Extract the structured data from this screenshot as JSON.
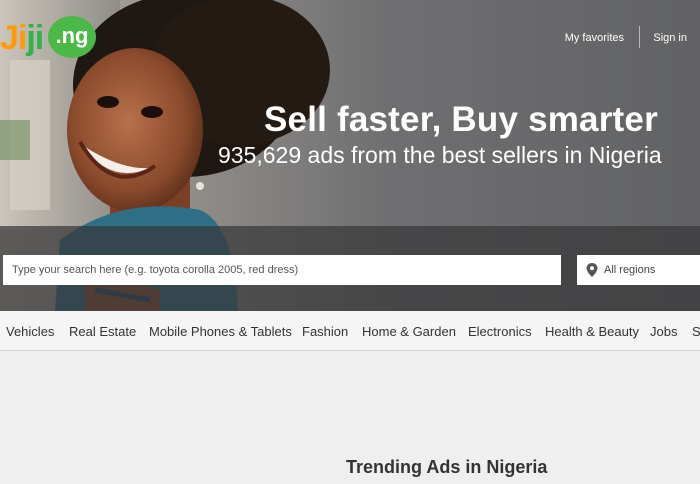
{
  "header": {
    "logo": {
      "part1": "Ji",
      "part2": "ji",
      "suffix": ".ng"
    },
    "favorites_label": "My favorites",
    "signin_label": "Sign in"
  },
  "hero": {
    "title": "Sell faster, Buy smarter",
    "subtitle": "935,629 ads from the best sellers in Nigeria"
  },
  "search": {
    "placeholder": "Type your search here (e.g. toyota corolla 2005, red dress)",
    "value": "",
    "region_label": "All regions"
  },
  "categories": [
    "Vehicles",
    "Real Estate",
    "Mobile Phones & Tablets",
    "Fashion",
    "Home & Garden",
    "Electronics",
    "Health & Beauty",
    "Jobs",
    "S"
  ],
  "main": {
    "trending_title": "Trending Ads in Nigeria"
  },
  "colors": {
    "brand_orange": "#ff9b00",
    "brand_green": "#4cb848",
    "search_band": "#3a3a3c"
  },
  "icons": {
    "region": "map-pin-icon"
  }
}
